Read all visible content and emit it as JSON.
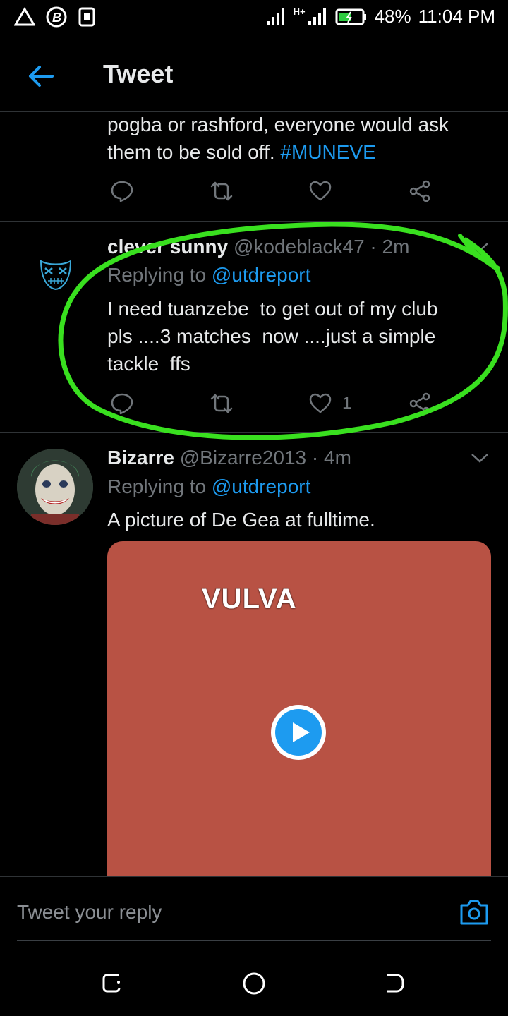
{
  "status_bar": {
    "battery": "48%",
    "time": "11:04 PM",
    "network": "H+"
  },
  "header": {
    "title": "Tweet"
  },
  "tweet_top": {
    "text_line1": "pogba or rashford, everyone would ask",
    "text_line2": "them to be sold off.",
    "hashtag": "#MUNEVE"
  },
  "reply1": {
    "name": "clever sunny",
    "handle": "@kodeblack47",
    "time": "· 2m",
    "replying_prefix": "Replying to",
    "replying_to": "@utdreport",
    "line1": "I need tuanzebe  to get out of my club",
    "line2": "pls ....3 matches  now ....just a simple",
    "line3": "tackle  ffs",
    "like_count": "1"
  },
  "reply2": {
    "name": "Bizarre",
    "handle": "@Bizarre2013",
    "time": "· 4m",
    "replying_prefix": "Replying to",
    "replying_to": "@utdreport",
    "text": "A picture of De Gea at fulltime.",
    "media_text": "VULVA"
  },
  "reply_input": {
    "placeholder": "Tweet your reply"
  },
  "colors": {
    "accent": "#1d9bf0",
    "highlight": "#39e01f",
    "media_bg": "#b85244"
  }
}
